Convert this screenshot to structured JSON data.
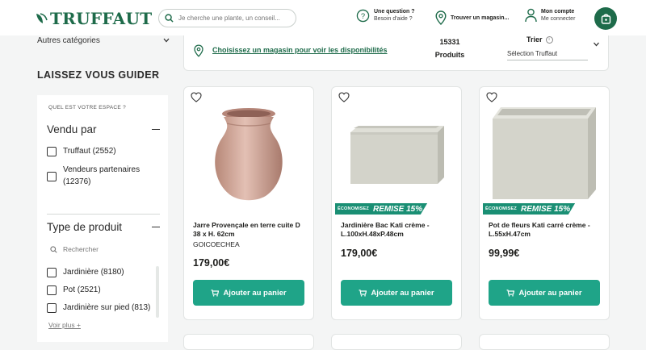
{
  "header": {
    "logo": "TRUFFAUT",
    "search_placeholder": "Je cherche une plante, un conseil...",
    "help": {
      "title": "Une question ?",
      "subtitle": "Besoin d'aide ?"
    },
    "store": {
      "title": "Trouver un magasin..."
    },
    "account": {
      "title": "Mon compte",
      "subtitle": "Me connecter"
    }
  },
  "sidebar": {
    "other_categories": "Autres catégories",
    "guide_title": "LAISSEZ VOUS GUIDER",
    "space_question": "QUEL EST VOTRE ESPACE ?",
    "sold_by": {
      "title": "Vendu par",
      "options": [
        {
          "label": "Truffaut (2552)"
        },
        {
          "label": "Vendeurs partenaires",
          "label2": "(12376)"
        }
      ]
    },
    "product_type": {
      "title": "Type de produit",
      "search_placeholder": "Rechercher",
      "options": [
        {
          "label": "Jardinière (8180)"
        },
        {
          "label": "Pot (2521)"
        },
        {
          "label": "Jardinière sur pied (813)"
        }
      ],
      "more": "Voir plus +"
    }
  },
  "topbar": {
    "store_link": "Choisissez un magasin pour voir les disponibilités",
    "count": "15331",
    "count_label": "Produits",
    "sort_label": "Trier",
    "sort_value": "Sélection Truffaut"
  },
  "products": [
    {
      "name": "Jarre Provençale en terre cuite D 38 x H. 62cm",
      "brand": "GOICOECHEA",
      "price": "179,00€",
      "badge_small": "",
      "badge_big": "",
      "button": "Ajouter au panier"
    },
    {
      "name": "Jardinière Bac Kati crème - L.100xH.48xP.48cm",
      "brand": "",
      "price": "179,00€",
      "badge_small": "ÉCONOMISEZ",
      "badge_big": "REMISE 15%",
      "button": "Ajouter au panier"
    },
    {
      "name": "Pot de fleurs Kati carré crème - L.55xH.47cm",
      "brand": "",
      "price": "99,99€",
      "badge_small": "ÉCONOMISEZ",
      "badge_big": "REMISE 15%",
      "button": "Ajouter au panier"
    }
  ],
  "colors": {
    "brand": "#1e6b4a",
    "accent": "#1fa488",
    "badge": "#1a8f74"
  }
}
